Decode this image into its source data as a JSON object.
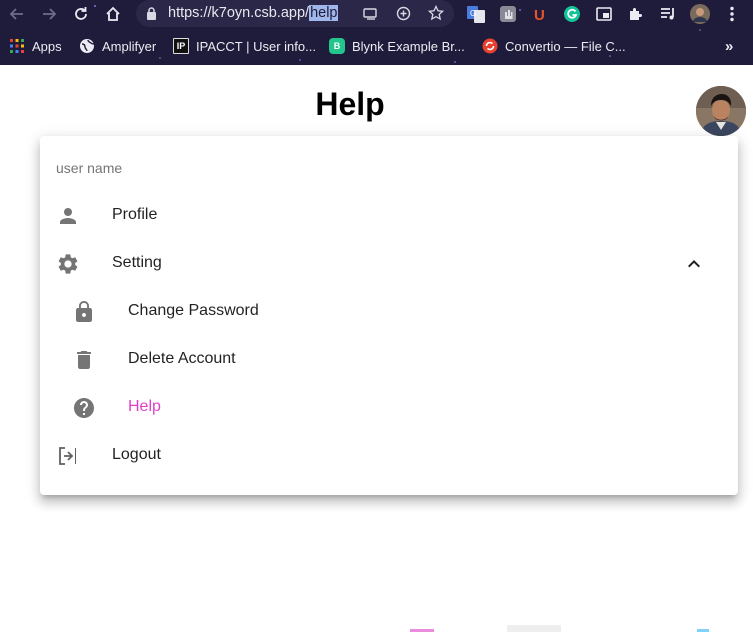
{
  "browser": {
    "url_base": "https://k7oyn.csb.app/",
    "url_path": "help",
    "bookmarks": [
      {
        "label": "Apps",
        "icon": "apps-grid-icon"
      },
      {
        "label": "Amplifyer",
        "icon": "globe-icon"
      },
      {
        "label": "IPACCT | User info...",
        "icon": "ipacct-icon"
      },
      {
        "label": "Blynk Example Br...",
        "icon": "blynk-icon"
      },
      {
        "label": "Convertio — File C...",
        "icon": "convertio-icon"
      }
    ],
    "more_bookmarks": "»"
  },
  "page": {
    "title": "Help"
  },
  "menu": {
    "subheader": "user name",
    "items": [
      {
        "label": "Profile",
        "icon": "person-icon"
      },
      {
        "label": "Setting",
        "icon": "gear-icon",
        "expanded": true
      },
      {
        "label": "Change Password",
        "icon": "lock-icon"
      },
      {
        "label": "Delete Account",
        "icon": "trash-icon"
      },
      {
        "label": "Help",
        "icon": "help-circle-icon",
        "active": true
      },
      {
        "label": "Logout",
        "icon": "logout-icon"
      }
    ]
  },
  "colors": {
    "chrome_bg": "#1f1b3a",
    "active_item": "#e040c8",
    "icon": "#757575"
  }
}
